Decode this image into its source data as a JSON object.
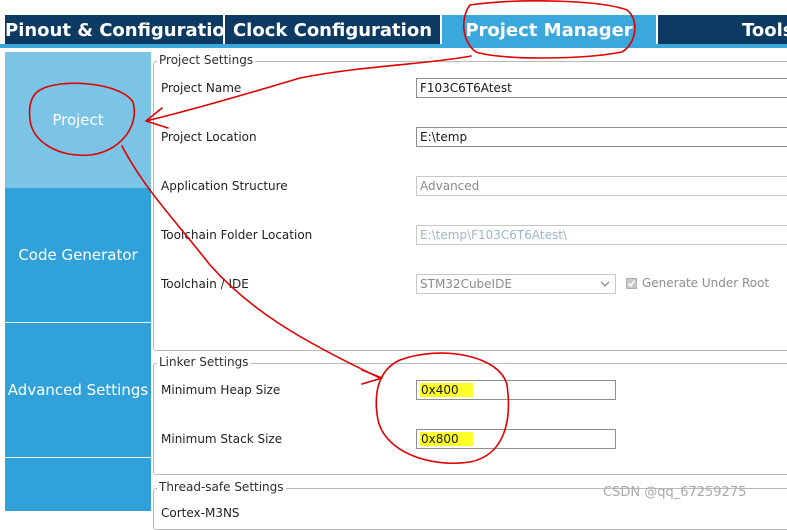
{
  "tabs": [
    {
      "label": "Pinout & Configuration"
    },
    {
      "label": "Clock Configuration"
    },
    {
      "label": "Project Manager"
    },
    {
      "label": "Tools"
    }
  ],
  "active_tab": "Project Manager",
  "sidebar": {
    "items": [
      {
        "label": "Project",
        "selected": true
      },
      {
        "label": "Code Generator",
        "selected": false
      },
      {
        "label": "Advanced Settings",
        "selected": false
      }
    ]
  },
  "project_settings": {
    "title": "Project Settings",
    "project_name": {
      "label": "Project Name",
      "value": "F103C6T6Atest"
    },
    "project_location": {
      "label": "Project Location",
      "value": "E:\\temp"
    },
    "application_structure": {
      "label": "Application Structure",
      "value": "Advanced"
    },
    "toolchain_folder": {
      "label": "Toolchain Folder Location",
      "value": "E:\\temp\\F103C6T6Atest\\"
    },
    "toolchain_ide": {
      "label": "Toolchain / IDE",
      "value": "STM32CubeIDE"
    },
    "generate_under_root": {
      "label": "Generate Under Root",
      "checked": true
    }
  },
  "linker_settings": {
    "title": "Linker Settings",
    "min_heap": {
      "label": "Minimum Heap Size",
      "value": "0x400"
    },
    "min_stack": {
      "label": "Minimum Stack Size",
      "value": "0x800"
    }
  },
  "thread_safe": {
    "title": "Thread-safe Settings",
    "partial_label": "Cortex-M3NS"
  },
  "watermark": "CSDN @qq_67259275",
  "colors": {
    "tab_bg": "#0d3a63",
    "tab_active": "#3aa7dd",
    "sidebar_selected": "#7cc4e6",
    "sidebar_normal": "#31a2d9",
    "highlight": "#ffff2a",
    "annotation_red": "#e00000"
  }
}
